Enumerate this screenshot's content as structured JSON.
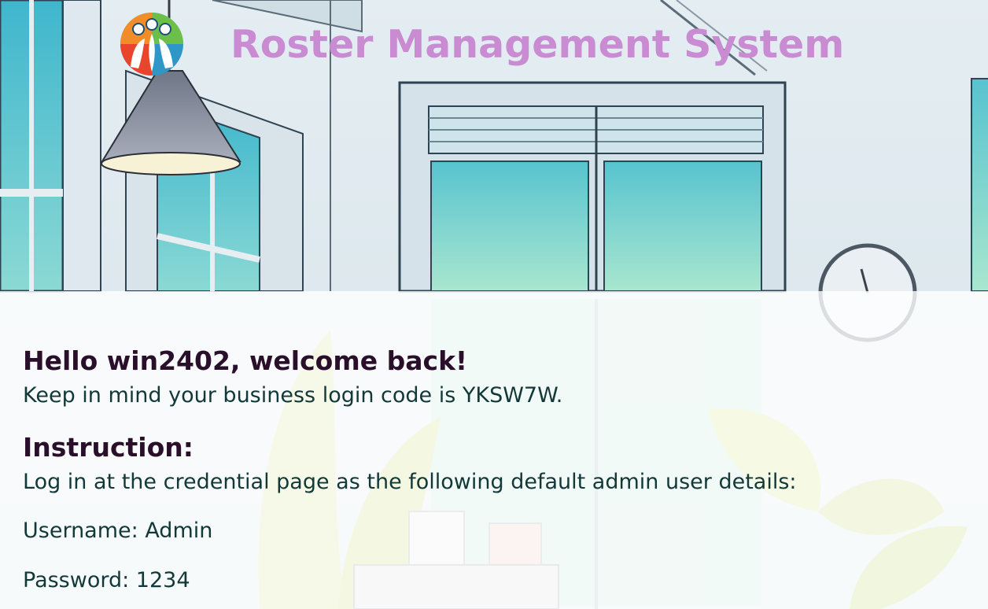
{
  "header": {
    "app_title": "Roster Management System",
    "logo_icon": "roster-people-logo"
  },
  "welcome": {
    "greeting": "Hello win2402, welcome back!",
    "login_code_note": "Keep in mind your business login code is YKSW7W."
  },
  "instruction": {
    "heading": "Instruction:",
    "text": "Log in at the credential page as the following default admin user details:",
    "username_line": "Username: Admin",
    "password_line": "Password: 1234"
  },
  "colors": {
    "title": "#c98bd2",
    "heading": "#2a0f2a",
    "body_text": "#123838"
  }
}
